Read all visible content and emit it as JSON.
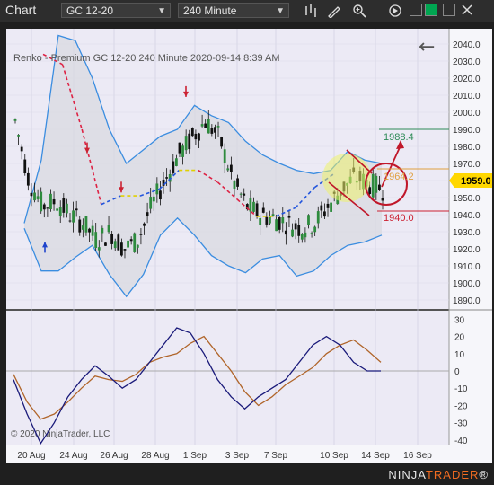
{
  "window": {
    "title": "Chart"
  },
  "toolbar": {
    "instrument": "GC 12-20",
    "interval": "240 Minute",
    "icons": [
      "bar-style-icon",
      "drawing-tool-icon",
      "zoom-icon",
      "scroll-icon"
    ],
    "color_swatches": [
      "#ffffff",
      "#00a651",
      "#f2f2f2",
      "#d9d9d9"
    ]
  },
  "chart": {
    "title": "Renko - Premium  GC 12-20  240 Minute  2020-09-14 8:39 AM",
    "copyright": "© 2020 NinjaTrader, LLC",
    "price_axis": {
      "min": 1885,
      "max": 2045,
      "ticks": [
        2040.0,
        2030.0,
        2020.0,
        2010.0,
        2000.0,
        1990.0,
        1980.0,
        1970.0,
        1960.0,
        1950.0,
        1940.0,
        1930.0,
        1920.0,
        1910.0,
        1900.0,
        1890.0
      ]
    },
    "current_price": "1959.0",
    "target_up": "1988.4",
    "target_mid": "1964.2",
    "target_down": "1940.0",
    "osc_axis": {
      "min": -45,
      "max": 35,
      "ticks": [
        30,
        20,
        10,
        0,
        -10,
        -20,
        -30,
        -40
      ]
    },
    "x_labels": [
      "20 Aug",
      "24 Aug",
      "26 Aug",
      "28 Aug",
      "1 Sep",
      "3 Sep",
      "7 Sep",
      "10 Sep",
      "14 Sep",
      "16 Sep"
    ],
    "back_arrow": "←"
  },
  "chart_data": {
    "type": "candlestick",
    "title": "Renko - Premium  GC 12-20  240 Minute  2020-09-14 8:39 AM",
    "x_labels": [
      "20 Aug",
      "24 Aug",
      "26 Aug",
      "28 Aug",
      "1 Sep",
      "3 Sep",
      "7 Sep",
      "10 Sep",
      "14 Sep",
      "16 Sep"
    ],
    "ylim": [
      1885,
      2045
    ],
    "levels": {
      "last": 1959.0,
      "upper_target": 1988.4,
      "mid_target": 1964.2,
      "lower_target": 1940.0
    },
    "band_upper": [
      1935,
      1972,
      2045,
      2042,
      2020,
      1990,
      1970,
      1978,
      1986,
      1990,
      2004,
      1998,
      1994,
      1983,
      1975,
      1970,
      1966,
      1964,
      1966,
      1977,
      1972,
      1970
    ],
    "band_lower": [
      1932,
      1907,
      1907,
      1915,
      1922,
      1905,
      1892,
      1905,
      1928,
      1938,
      1928,
      1916,
      1910,
      1906,
      1914,
      1916,
      1904,
      1907,
      1916,
      1922,
      1924,
      1928
    ],
    "moving_average": [
      2034,
      2028,
      1990,
      1946,
      1951,
      1951,
      1955,
      1966,
      1966,
      1959,
      1949,
      1939,
      1939,
      1944,
      1956,
      1964
    ],
    "oscillator": {
      "fast": [
        -5,
        -25,
        -42,
        -30,
        -15,
        -5,
        3,
        -3,
        -10,
        -5,
        5,
        15,
        25,
        22,
        10,
        -5,
        -15,
        -22,
        -15,
        -10,
        -5,
        5,
        15,
        20,
        15,
        5,
        0,
        0
      ],
      "slow": [
        -2,
        -18,
        -28,
        -25,
        -18,
        -10,
        -3,
        -5,
        -6,
        -2,
        5,
        8,
        10,
        16,
        20,
        10,
        0,
        -12,
        -20,
        -15,
        -8,
        -3,
        2,
        10,
        15,
        18,
        12,
        5
      ],
      "ylim": [
        -45,
        35
      ]
    }
  }
}
